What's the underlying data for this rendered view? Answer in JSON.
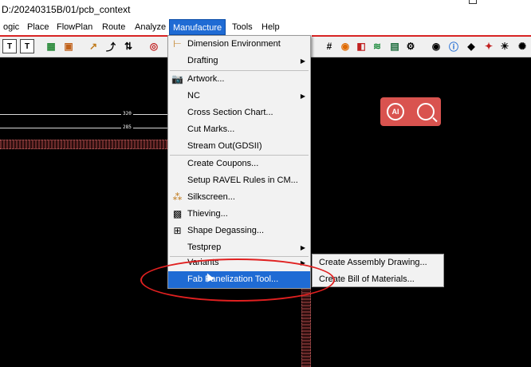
{
  "window": {
    "title": "D:/20240315B/01/pcb_context"
  },
  "menubar": {
    "items": [
      "ogic",
      "Place",
      "FlowPlan",
      "Route",
      "Analyze",
      "Manufacture",
      "Tools",
      "Help"
    ],
    "active": "Manufacture"
  },
  "canvas": {
    "dim_labels": [
      "320",
      "285"
    ]
  },
  "manufacture_menu": {
    "items": [
      {
        "label": "Dimension Environment",
        "icon": "dimension-icon",
        "submenu": false
      },
      {
        "label": "Drafting",
        "icon": "",
        "submenu": true
      },
      {
        "label": "Artwork...",
        "icon": "camera-icon",
        "submenu": false
      },
      {
        "label": "NC",
        "icon": "",
        "submenu": true
      },
      {
        "label": "Cross Section Chart...",
        "icon": "",
        "submenu": false
      },
      {
        "label": "Cut Marks...",
        "icon": "",
        "submenu": false
      },
      {
        "label": "Stream Out(GDSII)",
        "icon": "",
        "submenu": false
      },
      {
        "label": "Create Coupons...",
        "icon": "",
        "submenu": false
      },
      {
        "label": "Setup RAVEL Rules in CM...",
        "icon": "",
        "submenu": false
      },
      {
        "label": "Silkscreen...",
        "icon": "silkscreen-icon",
        "submenu": false
      },
      {
        "label": "Thieving...",
        "icon": "thieving-icon",
        "submenu": false
      },
      {
        "label": "Shape Degassing...",
        "icon": "degassing-icon",
        "submenu": false
      },
      {
        "label": "Testprep",
        "icon": "",
        "submenu": true
      },
      {
        "label": "Variants",
        "icon": "",
        "submenu": true
      },
      {
        "label": "Fab Panelization Tool...",
        "icon": "",
        "submenu": false,
        "highlighted": true
      }
    ]
  },
  "variants_submenu": {
    "items": [
      "Create Assembly Drawing...",
      "Create Bill of Materials..."
    ]
  },
  "ai_widget": {
    "label": "AI"
  },
  "colors": {
    "accent": "#1f6bd4",
    "annotation": "#e02020",
    "ai_widget": "#d9534f"
  }
}
